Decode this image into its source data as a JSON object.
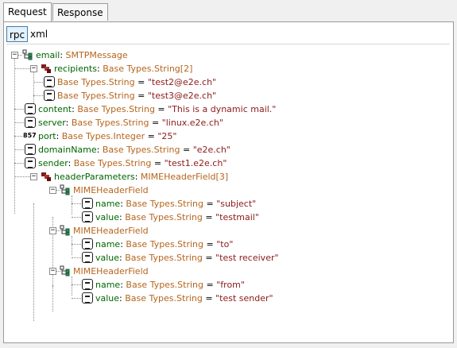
{
  "tabs": {
    "request": "Request",
    "response": "Response"
  },
  "subtabs": {
    "rpc": "rpc",
    "xml": "xml"
  },
  "tree": {
    "root": {
      "key": "email",
      "type": "SMTPMessage"
    },
    "recipients": {
      "key": "recipients",
      "type": "Base Types.String[2]"
    },
    "recip_item1": {
      "type": "Base Types.String",
      "eq": " = ",
      "value": "\"test2@e2e.ch\""
    },
    "recip_item2": {
      "type": "Base Types.String",
      "eq": " = ",
      "value": "\"test3@e2e.ch\""
    },
    "content": {
      "key": "content",
      "type": "Base Types.String",
      "eq": " = ",
      "value": "\"This is a dynamic mail.\""
    },
    "server": {
      "key": "server",
      "type": "Base Types.String",
      "eq": " = ",
      "value": "\"linux.e2e.ch\""
    },
    "port": {
      "key": "port",
      "type": "Base Types.Integer",
      "eq": " = ",
      "value": "\"25\""
    },
    "domainName": {
      "key": "domainName",
      "type": "Base Types.String",
      "eq": " = ",
      "value": "\"e2e.ch\""
    },
    "sender": {
      "key": "sender",
      "type": "Base Types.String",
      "eq": " = ",
      "value": "\"test1.e2e.ch\""
    },
    "headerParameters": {
      "key": "headerParameters",
      "type": "MIMEHeaderField[3]"
    },
    "h1": {
      "type": "MIMEHeaderField"
    },
    "h1_name": {
      "key": "name",
      "type": "Base Types.String",
      "eq": " = ",
      "value": "\"subject\""
    },
    "h1_value": {
      "key": "value",
      "type": "Base Types.String",
      "eq": " = ",
      "value": "\"testmail\""
    },
    "h2": {
      "type": "MIMEHeaderField"
    },
    "h2_name": {
      "key": "name",
      "type": "Base Types.String",
      "eq": " = ",
      "value": "\"to\""
    },
    "h2_value": {
      "key": "value",
      "type": "Base Types.String",
      "eq": " = ",
      "value": "\"test receiver\""
    },
    "h3": {
      "type": "MIMEHeaderField"
    },
    "h3_name": {
      "key": "name",
      "type": "Base Types.String",
      "eq": " = ",
      "value": "\"from\""
    },
    "h3_value": {
      "key": "value",
      "type": "Base Types.String",
      "eq": " = ",
      "value": "\"test sender\""
    }
  },
  "icons": {
    "struct": "struct-node-icon",
    "array": "array-node-icon",
    "scalar": "string-value-icon",
    "integer": "integer-value-icon",
    "integer_glyph": "857"
  },
  "colors": {
    "key": "#006400",
    "type": "#b5651d",
    "value": "#8b1a1a",
    "selection": "#e5f1fb"
  }
}
